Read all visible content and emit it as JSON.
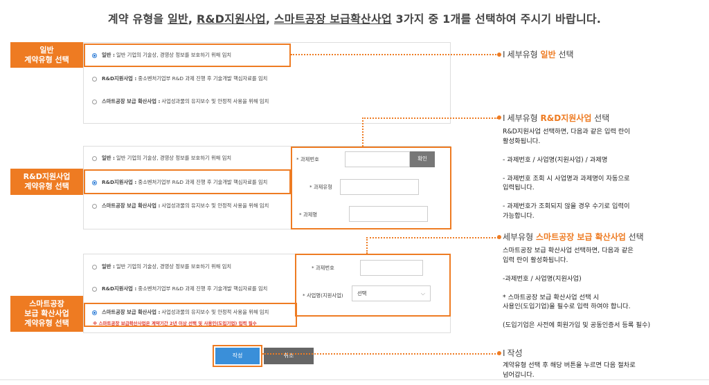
{
  "title": {
    "prefix": "계약 유형을 ",
    "type1": "일반",
    "sep1": ", ",
    "type2": "R&D지원사업",
    "sep2": ", ",
    "type3": "스마트공장 보급확산사업",
    "suffix": " 3가지 중 1개를 선택하여 주시기 바랍니다."
  },
  "options": {
    "general": {
      "name": "일반 :",
      "desc": "일반 기업의 기술상, 경영상 정보를 보호하기 위해 임치"
    },
    "rnd": {
      "name": "R&D지원사업 :",
      "desc": "중소벤처기업부 R&D 과제 진행 후 기술개발 핵심자료를 임치"
    },
    "smart": {
      "name": "스마트공장 보급 확산사업 :",
      "desc": "사업성과물의 유지보수 및 안정적 사용을 위해 임치"
    }
  },
  "tags": {
    "general": [
      "일반",
      "계약유형 선택"
    ],
    "rnd": [
      "R&D지원사업",
      "계약유형 선택"
    ],
    "smart": [
      "스마트공장",
      "보급 확산사업",
      "계약유형 선택"
    ]
  },
  "rnd_form": {
    "project_no_label": "* 과제번호",
    "confirm_label": "확인",
    "project_type_label": "* 과제유형",
    "project_name_label": "* 과제명"
  },
  "smart_form": {
    "project_no_label": "* 과제번호",
    "business_label": "* 사업명(지원사업)",
    "business_value": "선택"
  },
  "smart_warning": "※ 스마트공장 보급확산사업은 계약기간 2년 이상 선택 및 사용인(도입기업) 입력 필수",
  "annotations": {
    "general": {
      "bar": "I",
      "pre": "세부유형 ",
      "accent": "일반",
      "post": " 선택"
    },
    "rnd": {
      "bar": "I",
      "pre": "세부유형 ",
      "accent": "R&D지원사업",
      "post": " 선택",
      "body": "R&D지원사업 선택하면, 다음과 같은 입력 란이\n활성화됩니다.\n\n- 과제번호 / 사업명(지원사업) / 과제명\n\n- 과제번호 조회 시 사업명과 과제명이 자동으로\n입력됩니다.\n\n- 과제번호가 조회되지 않을 경우 수기로 입력이\n가능합니다."
    },
    "smart": {
      "pre": "세부유형 ",
      "accent": "스마트공장 보급 확산사업",
      "post": " 선택",
      "body": "스마트공장 보급 확산사업 선택하면, 다음과 같은\n입력 란이 활성화됩니다.\n\n-과제번호 / 사업명(지원사업)\n\n* 스마트공장 보급 확산사업 선택 시\n사용인(도입기업)을 필수로 입력 하여야 합니다.\n\n (도입기업은 사전에 회원가입 및 공동인증서 등록 필수)"
    },
    "write": {
      "bar": "I",
      "label": "작성",
      "body": "계약유형 선택 후 해당 버튼을 누르면 다음 절차로\n넘어갑니다."
    }
  },
  "buttons": {
    "write": "작성",
    "cancel": "취소"
  },
  "colors": {
    "accent": "#ee7b22",
    "primary": "#3a8fd9",
    "warning": "#e03b2f"
  }
}
